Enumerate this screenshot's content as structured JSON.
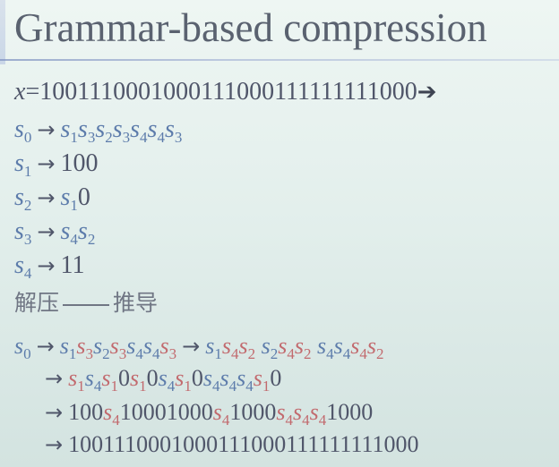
{
  "title": "Grammar-based compression",
  "sequence": {
    "var": "x",
    "eq": "=",
    "value": "1001110001000111000111111111000"
  },
  "rules": {
    "s0": {
      "lhs": "s",
      "lhs_sub": "0",
      "rhs": [
        [
          "s",
          "1"
        ],
        [
          "s",
          "3"
        ],
        [
          "s",
          "2"
        ],
        [
          "s",
          "3"
        ],
        [
          "s",
          "4"
        ],
        [
          "s",
          "4"
        ],
        [
          "s",
          "3"
        ]
      ]
    },
    "s1": {
      "lhs": "s",
      "lhs_sub": "1",
      "rhs_text": "100"
    },
    "s2": {
      "lhs": "s",
      "lhs_sub": "2",
      "rhs_sym": "s",
      "rhs_sym_sub": "1",
      "rhs_text": "0"
    },
    "s3": {
      "lhs": "s",
      "lhs_sub": "3",
      "rhs": [
        [
          "s",
          "4"
        ],
        [
          "s",
          "2"
        ]
      ]
    },
    "s4": {
      "lhs": "s",
      "lhs_sub": "4",
      "rhs_text": "11"
    }
  },
  "section": {
    "left": "解压",
    "right": "推导"
  },
  "derivation": {
    "line4_text": "1001110001000111000111111111000",
    "line3_a": "100",
    "line3_b": "10001000",
    "line3_c": "1000",
    "line3_d": "1000"
  },
  "colors": {
    "symbol": "#5d7cab",
    "highlight": "#c26a6e",
    "text": "#50566a"
  }
}
